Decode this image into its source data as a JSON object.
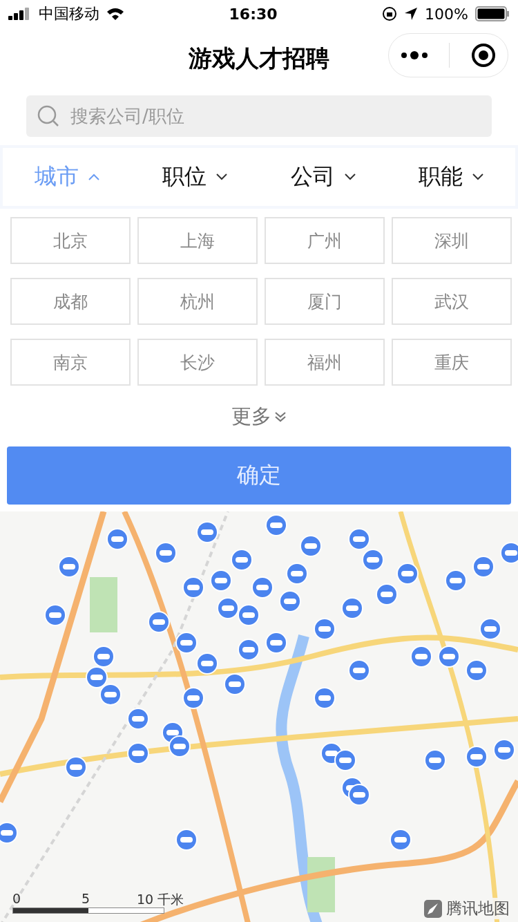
{
  "status_bar": {
    "carrier": "中国移动",
    "time": "16:30",
    "battery": "100%"
  },
  "title": "游戏人才招聘",
  "search": {
    "placeholder": "搜索公司/职位"
  },
  "filters": [
    {
      "label": "城市",
      "selected": true
    },
    {
      "label": "职位",
      "selected": false
    },
    {
      "label": "公司",
      "selected": false
    },
    {
      "label": "职能",
      "selected": false
    }
  ],
  "cities": [
    "北京",
    "上海",
    "广州",
    "深圳",
    "成都",
    "杭州",
    "厦门",
    "武汉",
    "南京",
    "长沙",
    "福州",
    "重庆"
  ],
  "more": "更多",
  "confirm": "确定",
  "map": {
    "scale_labels": [
      "0",
      "5",
      "10 千米"
    ],
    "attribution": "腾讯地图"
  }
}
